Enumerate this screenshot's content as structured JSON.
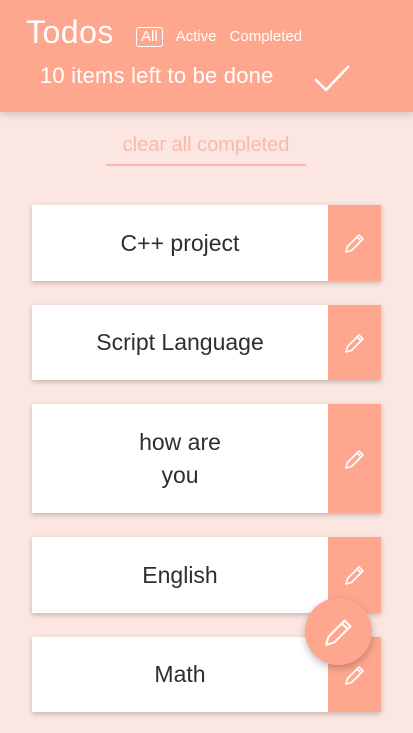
{
  "header": {
    "title": "Todos",
    "filters": [
      "All",
      "Active",
      "Completed"
    ],
    "items_left": "10 items left to be done",
    "check_icon": "check-icon"
  },
  "clear_completed": "clear all completed",
  "todos": [
    {
      "text": "C++ project",
      "edit_icon": "pencil-icon"
    },
    {
      "text": "Script Language",
      "edit_icon": "pencil-icon"
    },
    {
      "text": "how are\nyou",
      "edit_icon": "pencil-icon"
    },
    {
      "text": "English",
      "edit_icon": "pencil-icon"
    },
    {
      "text": "Math",
      "edit_icon": "pencil-icon"
    }
  ],
  "fab_icon": "pencil-icon",
  "colors": {
    "accent": "#ffa78e",
    "background": "#fbe6e1",
    "link": "#fbb9aa"
  }
}
